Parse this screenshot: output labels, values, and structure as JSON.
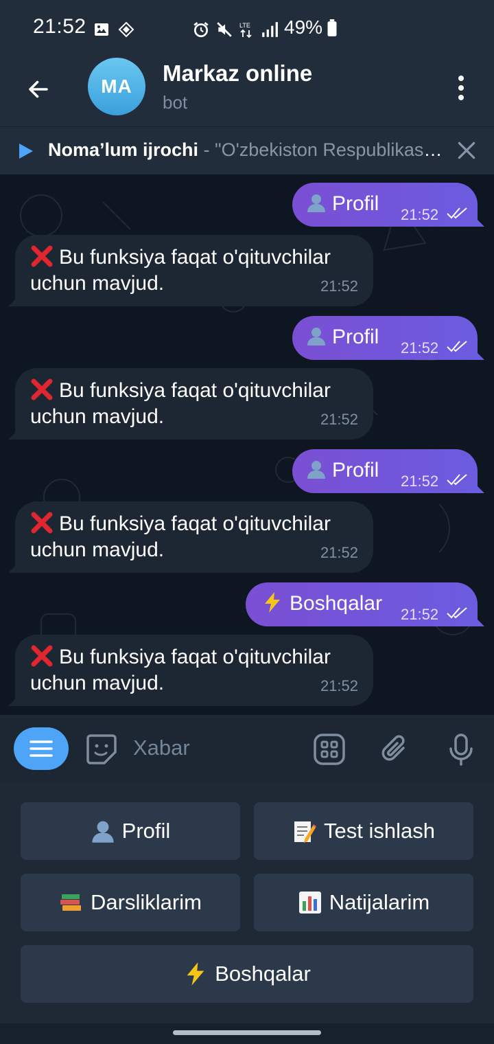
{
  "status_bar": {
    "time": "21:52",
    "battery_text": "49%",
    "network": "LTE"
  },
  "header": {
    "avatar_initials": "MA",
    "title": "Markaz online",
    "subtitle": "bot"
  },
  "music_bar": {
    "artist": "Noma’lum ijrochi",
    "separator": " - ",
    "song": "\"O'zbekiston Respublikasining Davlat madhiyasi\""
  },
  "messages": [
    {
      "direction": "out",
      "emoji": "user-icon",
      "text": "Profil",
      "time": "21:52"
    },
    {
      "direction": "in",
      "emoji": "cross-icon",
      "text": "Bu funksiya faqat o'qituvchilar uchun mavjud.",
      "time": "21:52"
    },
    {
      "direction": "out",
      "emoji": "user-icon",
      "text": "Profil",
      "time": "21:52"
    },
    {
      "direction": "in",
      "emoji": "cross-icon",
      "text": "Bu funksiya faqat o'qituvchilar uchun mavjud.",
      "time": "21:52"
    },
    {
      "direction": "out",
      "emoji": "user-icon",
      "text": "Profil",
      "time": "21:52"
    },
    {
      "direction": "in",
      "emoji": "cross-icon",
      "text": "Bu funksiya faqat o'qituvchilar uchun mavjud.",
      "time": "21:52"
    },
    {
      "direction": "out",
      "emoji": "lightning-icon",
      "text": "Boshqalar",
      "time": "21:52"
    },
    {
      "direction": "in",
      "emoji": "cross-icon",
      "text": "Bu funksiya faqat o'qituvchilar uchun mavjud.",
      "time": "21:52"
    }
  ],
  "input_bar": {
    "placeholder": "Xabar",
    "value": ""
  },
  "keyboard": {
    "buttons": [
      {
        "emoji": "user-icon",
        "label": "Profil"
      },
      {
        "emoji": "memo-icon",
        "label": "Test ishlash"
      },
      {
        "emoji": "books-icon",
        "label": "Darsliklarim"
      },
      {
        "emoji": "bar-chart-icon",
        "label": "Natijalarim"
      },
      {
        "emoji": "lightning-icon",
        "label": "Boshqalar"
      }
    ]
  },
  "colors": {
    "accent": "#4ea4f6",
    "outgoing_bubble": "#7052d8",
    "incoming_bubble": "#1c2733",
    "chat_background": "#0e1621",
    "header_background": "#212d3b"
  }
}
